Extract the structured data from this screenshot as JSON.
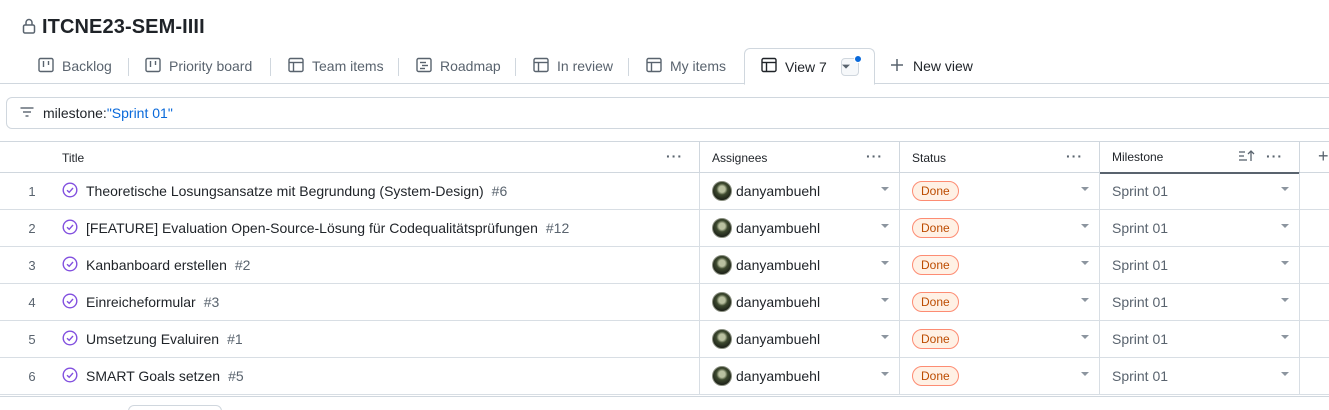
{
  "project": {
    "title": "ITCNE23-SEM-IIII",
    "icon": "lock-icon"
  },
  "tabs": [
    {
      "label": "Backlog",
      "icon": "board-icon"
    },
    {
      "label": "Priority board",
      "icon": "board-icon"
    },
    {
      "label": "Team items",
      "icon": "table-icon"
    },
    {
      "label": "Roadmap",
      "icon": "roadmap-icon"
    },
    {
      "label": "In review",
      "icon": "table-icon"
    },
    {
      "label": "My items",
      "icon": "table-icon"
    },
    {
      "label": "View 7",
      "icon": "table-icon",
      "active": true
    }
  ],
  "new_view_label": "New view",
  "filter": {
    "key": "milestone:",
    "value": "\"Sprint 01\""
  },
  "columns": {
    "title": "Title",
    "assignees": "Assignees",
    "status": "Status",
    "milestone": "Milestone"
  },
  "rows": [
    {
      "num": "1",
      "title": "Theoretische Losungsansatze mit Begrundung (System-Design)",
      "issue": "#6",
      "assignee": "danyambuehl",
      "status": "Done",
      "milestone": "Sprint 01"
    },
    {
      "num": "2",
      "title": "[FEATURE] Evaluation Open-Source-Lösung für Codequalitätsprüfungen",
      "issue": "#12",
      "assignee": "danyambuehl",
      "status": "Done",
      "milestone": "Sprint 01"
    },
    {
      "num": "3",
      "title": "Kanbanboard erstellen",
      "issue": "#2",
      "assignee": "danyambuehl",
      "status": "Done",
      "milestone": "Sprint 01"
    },
    {
      "num": "4",
      "title": "Einreicheformular",
      "issue": "#3",
      "assignee": "danyambuehl",
      "status": "Done",
      "milestone": "Sprint 01"
    },
    {
      "num": "5",
      "title": "Umsetzung Evaluiren",
      "issue": "#1",
      "assignee": "danyambuehl",
      "status": "Done",
      "milestone": "Sprint 01"
    },
    {
      "num": "6",
      "title": "SMART Goals setzen",
      "issue": "#5",
      "assignee": "danyambuehl",
      "status": "Done",
      "milestone": "Sprint 01"
    }
  ],
  "colors": {
    "accent": "#0969da",
    "done_text": "#bc4c00",
    "done_bg": "#fff1e5",
    "closed_issue": "#8250df"
  }
}
